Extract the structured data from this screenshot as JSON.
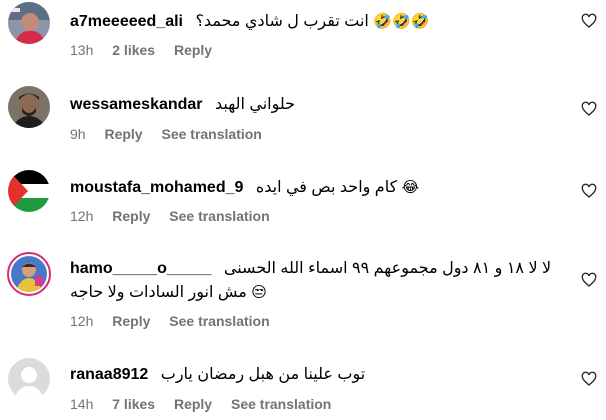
{
  "comments": [
    {
      "username": "a7meeeeed_ali",
      "text": "انت تقرب ل شادي محمد؟",
      "emoji": "🤣🤣🤣",
      "time": "13h",
      "likes": "2 likes",
      "reply": "Reply"
    },
    {
      "username": "wessameskandar",
      "text": "حلواني الهبد",
      "time": "9h",
      "reply": "Reply",
      "see_translation": "See translation"
    },
    {
      "username": "moustafa_mohamed_9",
      "text": "كام واحد بص في ايده",
      "emoji": "😂",
      "time": "12h",
      "reply": "Reply",
      "see_translation": "See translation"
    },
    {
      "username": "hamo_____o_____",
      "text": "لا لا ١٨ و ٨١ دول مجموعهم ٩٩ اسماء الله الحسنى",
      "text2": "مش انور السادات ولا حاجه",
      "emoji2": "😒",
      "time": "12h",
      "reply": "Reply",
      "see_translation": "See translation"
    },
    {
      "username": "ranaa8912",
      "text": "توب علينا من هبل رمضان يارب",
      "time": "14h",
      "likes": "7 likes",
      "reply": "Reply",
      "see_translation": "See translation"
    }
  ],
  "colors": {
    "meta": "#737373",
    "heart_stroke": "#262626"
  },
  "icons": {
    "like": "heart-outline-icon"
  }
}
